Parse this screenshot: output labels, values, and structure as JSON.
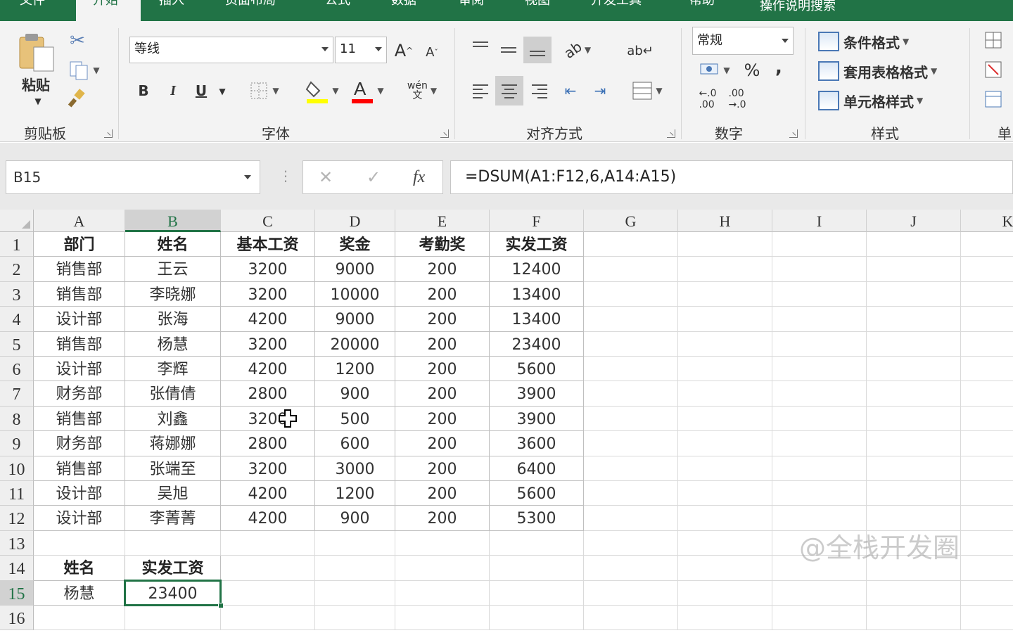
{
  "ribbon_tabs": [
    "文件",
    "开始",
    "插入",
    "页面布局",
    "公式",
    "数据",
    "审阅",
    "视图",
    "开发工具",
    "帮助",
    "操作说明搜索"
  ],
  "clipboard": {
    "paste_label": "粘贴",
    "group_label": "剪贴板"
  },
  "font": {
    "name": "等线",
    "size": "11",
    "bold": "B",
    "italic": "I",
    "underline": "U",
    "grow": "A",
    "shrink": "A",
    "phonetic": "wén",
    "group_label": "字体",
    "fill_color": "#ffff00",
    "font_color": "#ff0000"
  },
  "alignment": {
    "group_label": "对齐方式"
  },
  "number": {
    "format": "常规",
    "percent": "%",
    "comma": ",",
    "group_label": "数字"
  },
  "styles": {
    "conditional": "条件格式",
    "table_format": "套用表格格式",
    "cell_styles": "单元格样式",
    "group_label": "样式"
  },
  "cells_group": {
    "group_label": "单"
  },
  "formula_bar": {
    "name_box": "B15",
    "cancel": "✕",
    "enter": "✓",
    "fx": "fx",
    "formula": "=DSUM(A1:F12,6,A14:A15)"
  },
  "columns": [
    "A",
    "B",
    "C",
    "D",
    "E",
    "F",
    "G",
    "H",
    "I",
    "J",
    "K"
  ],
  "rows": [
    "1",
    "2",
    "3",
    "4",
    "5",
    "6",
    "7",
    "8",
    "9",
    "10",
    "11",
    "12",
    "13",
    "14",
    "15",
    "16"
  ],
  "table": {
    "headers": [
      "部门",
      "姓名",
      "基本工资",
      "奖金",
      "考勤奖",
      "实发工资"
    ],
    "data": [
      [
        "销售部",
        "王云",
        "3200",
        "9000",
        "200",
        "12400"
      ],
      [
        "销售部",
        "李晓娜",
        "3200",
        "10000",
        "200",
        "13400"
      ],
      [
        "设计部",
        "张海",
        "4200",
        "9000",
        "200",
        "13400"
      ],
      [
        "销售部",
        "杨慧",
        "3200",
        "20000",
        "200",
        "23400"
      ],
      [
        "设计部",
        "李辉",
        "4200",
        "1200",
        "200",
        "5600"
      ],
      [
        "财务部",
        "张倩倩",
        "2800",
        "900",
        "200",
        "3900"
      ],
      [
        "销售部",
        "刘鑫",
        "3200",
        "500",
        "200",
        "3900"
      ],
      [
        "财务部",
        "蒋娜娜",
        "2800",
        "600",
        "200",
        "3600"
      ],
      [
        "销售部",
        "张端至",
        "3200",
        "3000",
        "200",
        "6400"
      ],
      [
        "设计部",
        "吴旭",
        "4200",
        "1200",
        "200",
        "5600"
      ],
      [
        "设计部",
        "李菁菁",
        "4200",
        "900",
        "200",
        "5300"
      ]
    ]
  },
  "criteria": {
    "headers": [
      "姓名",
      "实发工资"
    ],
    "values": [
      "杨慧",
      "23400"
    ]
  },
  "watermark": "@全栈开发圈",
  "colors": {
    "accent": "#217346",
    "ribbon_bg": "#f3f3f3"
  }
}
